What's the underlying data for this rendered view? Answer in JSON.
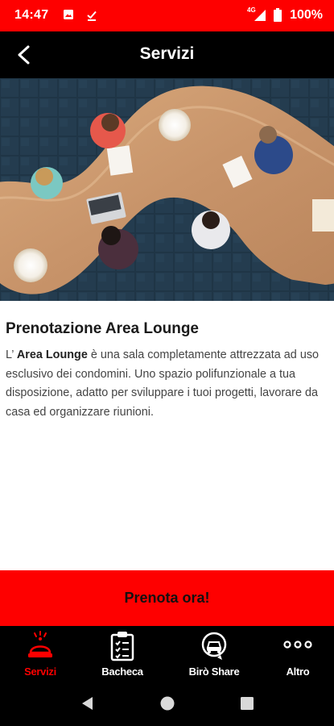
{
  "status_bar": {
    "time": "14:47",
    "network": "4G",
    "battery": "100%",
    "icons": [
      "image-icon",
      "download-done-icon",
      "signal-icon",
      "battery-icon"
    ]
  },
  "app_bar": {
    "title": "Servizi",
    "back_icon": "arrow-back-icon"
  },
  "hero": {
    "icon": "lounge-photo"
  },
  "content": {
    "heading": "Prenotazione Area Lounge",
    "text_prefix": "L’ ",
    "text_bold": "Area Lounge",
    "text_rest": " è una sala completamente attrezzata ad uso esclusivo dei condomini. Uno spazio polifunzionale a tua disposizione, adatto per sviluppare i tuoi progetti, lavorare da casa ed organizzare riunioni."
  },
  "cta": {
    "label": "Prenota ora!"
  },
  "bottom_nav": {
    "items": [
      {
        "label": "Servizi",
        "icon": "service-bell-icon",
        "active": true
      },
      {
        "label": "Bacheca",
        "icon": "clipboard-checklist-icon",
        "active": false
      },
      {
        "label": "Birò Share",
        "icon": "car-share-icon",
        "active": false
      },
      {
        "label": "Altro",
        "icon": "more-dots-icon",
        "active": false
      }
    ]
  },
  "colors": {
    "accent": "#fe0000",
    "bar": "#000000",
    "text": "#444444"
  },
  "system_nav": {
    "icons": [
      "back-triangle-icon",
      "home-circle-icon",
      "recents-square-icon"
    ]
  }
}
